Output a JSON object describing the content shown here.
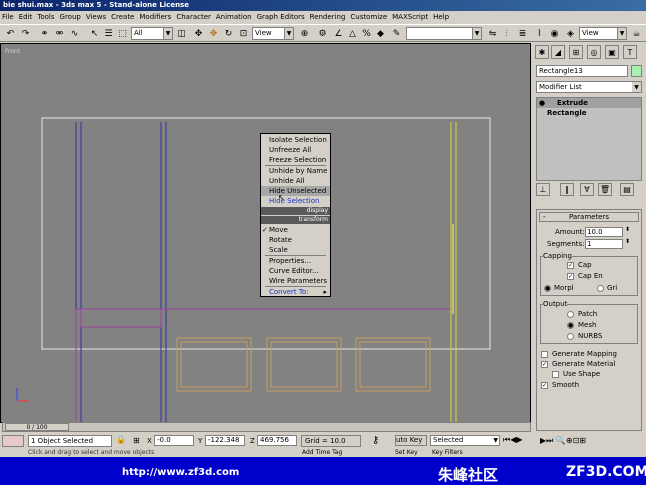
{
  "window": {
    "title": "bie shui.max - 3ds max 5 - Stand-alone License"
  },
  "menu": [
    "File",
    "Edit",
    "Tools",
    "Group",
    "Views",
    "Create",
    "Modifiers",
    "Character",
    "Animation",
    "Graph Editors",
    "Rendering",
    "Customize",
    "MAXScript",
    "Help"
  ],
  "toolbar": {
    "filter_value": "All",
    "coord_value": "View",
    "named_sel_value": "",
    "render_view_value": "View"
  },
  "viewport": {
    "label": "Front"
  },
  "context_menu": {
    "top_items": [
      "Isolate Selection",
      "Unfreeze All",
      "Freeze Selection",
      "Unhide by Name",
      "Unhide All",
      "Hide Unselected",
      "Hide Selection"
    ],
    "display_head": "display",
    "transform_head": "transform",
    "bottom_items": [
      "Move",
      "Rotate",
      "Scale",
      "Properties...",
      "Curve Editor...",
      "Wire Parameters",
      "Convert To:"
    ],
    "checked_item": "Move"
  },
  "command_panel": {
    "object_name": "Rectangle13",
    "modifier_list": "Modifier List",
    "stack": [
      "Extrude",
      "Rectangle"
    ],
    "parameters_title": "Parameters",
    "amount_label": "Amount:",
    "amount_value": "10.0",
    "segments_label": "Segments:",
    "segments_value": "1",
    "capping_label": "Capping",
    "cap_start": "Cap",
    "cap_end": "Cap En",
    "morph": "Morpl",
    "grid": "Gri",
    "output_label": "Output",
    "patch": "Patch",
    "mesh": "Mesh",
    "nurbs": "NURBS",
    "gen_mapping": "Generate Mapping",
    "gen_material": "Generate Material",
    "use_shape": "Use Shape",
    "smooth": "Smooth"
  },
  "status": {
    "frame_slider": "0 / 100",
    "selection": "1 Object Selected",
    "x_label": "X",
    "x_value": "-0.0",
    "y_label": "Y",
    "y_value": "-122.348",
    "z_label": "Z",
    "z_value": "469.756",
    "grid": "Grid = 10.0",
    "auto_key": "uto Key",
    "set_key": "Set Key",
    "key_mode": "Selected",
    "key_filters": "Key Filters",
    "prompt": "Click and drag to select and move objects",
    "add_time_tag": "Add Time Tag"
  },
  "ad": {
    "url": "http://www.zf3d.com",
    "cn": "朱峰社区",
    "site": "ZF3D.COM"
  }
}
